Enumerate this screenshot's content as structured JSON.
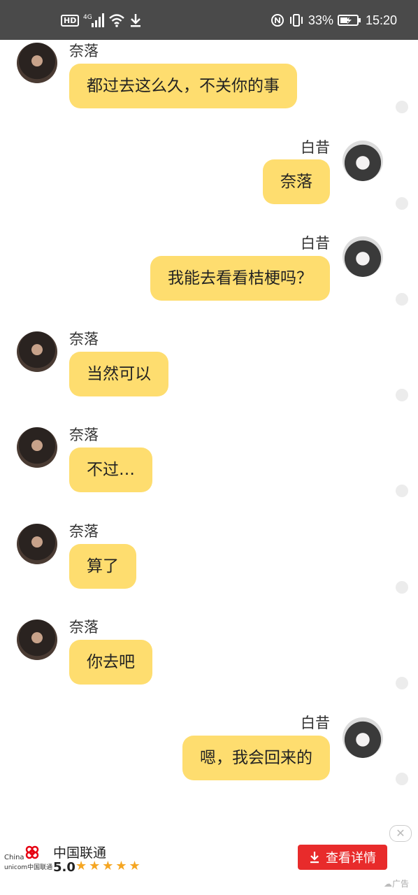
{
  "status_bar": {
    "hd": "HD",
    "network": "4G",
    "battery_percent": "33%",
    "time": "15:20",
    "icons": [
      "hd-icon",
      "signal-icon",
      "wifi-icon",
      "download-icon",
      "nfc-icon",
      "vibrate-icon",
      "battery-charging-icon"
    ]
  },
  "messages": [
    {
      "side": "left",
      "sender": "奈落",
      "text": "都过去这么久，不关你的事"
    },
    {
      "side": "right",
      "sender": "白昔",
      "text": "奈落"
    },
    {
      "side": "right",
      "sender": "白昔",
      "text": "我能去看看桔梗吗？"
    },
    {
      "side": "left",
      "sender": "奈落",
      "text": "当然可以"
    },
    {
      "side": "left",
      "sender": "奈落",
      "text": "不过…"
    },
    {
      "side": "left",
      "sender": "奈落",
      "text": "算了"
    },
    {
      "side": "left",
      "sender": "奈落",
      "text": "你去吧"
    },
    {
      "side": "right",
      "sender": "白昔",
      "text": "嗯，我会回来的"
    }
  ],
  "ad": {
    "logo_text_line1": "China",
    "logo_text_line2": "unicom中国联通",
    "name": "中国联通",
    "rating": "5.0",
    "stars": "★★★★★",
    "button_label": "查看详情",
    "close_symbol": "✕",
    "tag": "广告",
    "colors": {
      "button": "#e82b2b",
      "stars": "#f5a623"
    }
  },
  "colors": {
    "bubble": "#fedd6f",
    "status_bar": "#4a4a4a"
  }
}
